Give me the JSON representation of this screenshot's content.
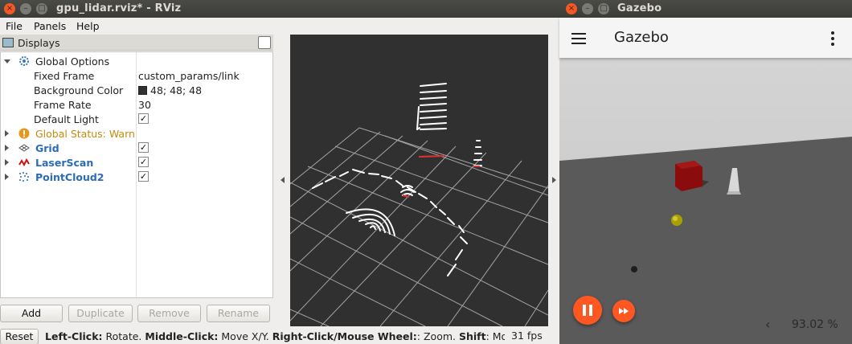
{
  "rviz": {
    "window_title": "gpu_lidar.rviz* - RViz",
    "menu": {
      "file": "File",
      "panels": "Panels",
      "help": "Help"
    },
    "displays_panel": {
      "title": "Displays",
      "rows": [
        {
          "label": "Global Options",
          "value": ""
        },
        {
          "label": "Fixed Frame",
          "value": "custom_params/link"
        },
        {
          "label": "Background Color",
          "value": "48; 48; 48"
        },
        {
          "label": "Frame Rate",
          "value": "30"
        },
        {
          "label": "Default Light",
          "value": ""
        },
        {
          "label": "Global Status: Warn",
          "value": ""
        },
        {
          "label": "Grid",
          "value": ""
        },
        {
          "label": "LaserScan",
          "value": ""
        },
        {
          "label": "PointCloud2",
          "value": ""
        }
      ],
      "check_mark": "✓",
      "background_color_hex": "#303030"
    },
    "buttons": {
      "add": "Add",
      "duplicate": "Duplicate",
      "remove": "Remove",
      "rename": "Rename"
    },
    "status": {
      "reset": "Reset",
      "left_click_key": "Left-Click:",
      "left_click_val": " Rotate. ",
      "middle_click_key": "Middle-Click:",
      "middle_click_val": " Move X/Y. ",
      "right_click_key": "Right-Click/Mouse Wheel:",
      "right_click_val": ": Zoom. ",
      "shift_key": "Shift",
      "shift_val": ": More options.",
      "fps": "31 fps"
    }
  },
  "gazebo": {
    "window_title": "Gazebo",
    "app_title": "Gazebo",
    "real_time_factor": "93.02 %",
    "rtf_chevron": "‹",
    "pause_icon": "pause-icon",
    "step_icon": "fast-forward-icon"
  },
  "colors": {
    "accent_orange": "#ff5722",
    "warn": "#c48a0c",
    "display_blue": "#2a6db5",
    "viewport_bg": "#303030"
  }
}
